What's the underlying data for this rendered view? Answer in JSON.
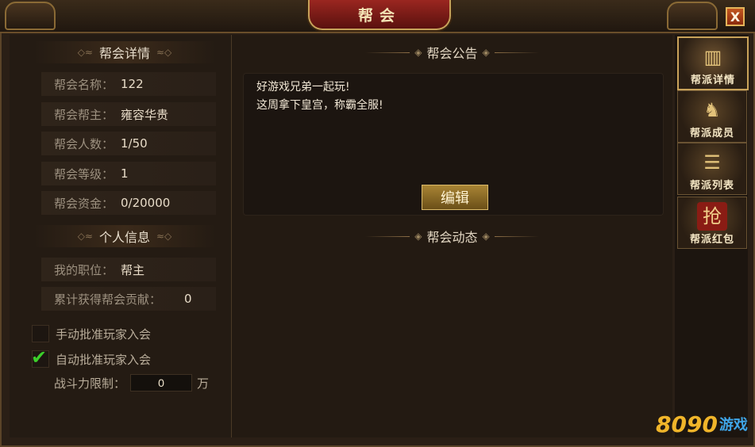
{
  "window": {
    "title": "帮会",
    "close_label": "X"
  },
  "guild_details": {
    "heading": "帮会详情",
    "rows": [
      {
        "label": "帮会名称：",
        "value": "122"
      },
      {
        "label": "帮会帮主：",
        "value": "雍容华贵"
      },
      {
        "label": "帮会人数：",
        "value": "1/50"
      },
      {
        "label": "帮会等级：",
        "value": "1"
      },
      {
        "label": "帮会资金：",
        "value": "0/20000"
      }
    ]
  },
  "personal_info": {
    "heading": "个人信息",
    "position_label": "我的职位：",
    "position_value": "帮主",
    "contribution_label": "累计获得帮会贡献：",
    "contribution_value": "0"
  },
  "approval": {
    "manual_label": "手动批准玩家入会",
    "manual_checked": false,
    "auto_label": "自动批准玩家入会",
    "auto_checked": true,
    "power_label": "战斗力限制：",
    "power_value": "0",
    "power_unit": "万"
  },
  "notice": {
    "heading": "帮会公告",
    "lines": [
      "好游戏兄弟一起玩!",
      "这周拿下皇宫，称霸全服!"
    ],
    "edit_label": "编辑"
  },
  "activity": {
    "heading": "帮会动态"
  },
  "tabs": [
    {
      "label": "帮派详情",
      "icon": "book-icon",
      "active": true
    },
    {
      "label": "帮派成员",
      "icon": "helmet-icon",
      "active": false
    },
    {
      "label": "帮派列表",
      "icon": "scroll-icon",
      "active": false
    },
    {
      "label": "帮派红包",
      "icon": "red-envelope-icon",
      "active": false
    }
  ],
  "watermark": {
    "number": "8090",
    "text": "游戏"
  }
}
